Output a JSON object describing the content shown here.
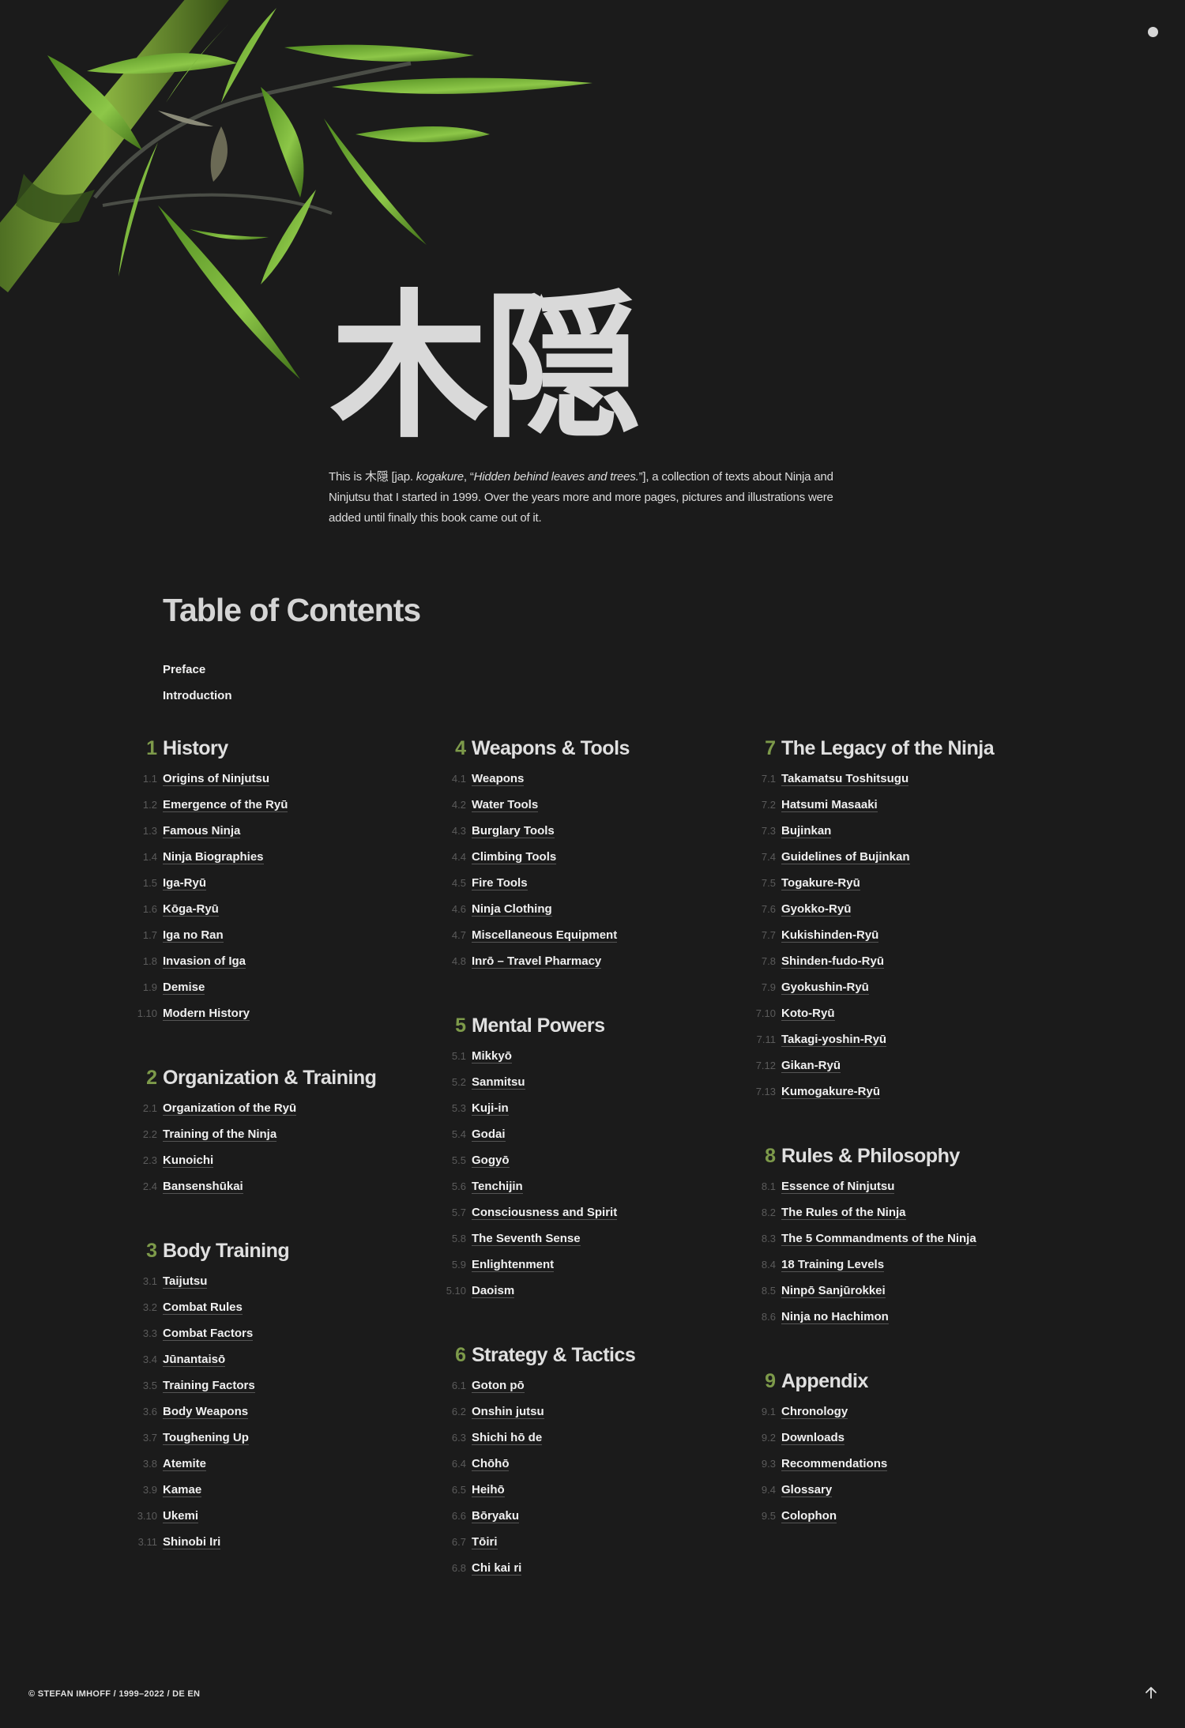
{
  "hero": {
    "kanji": "木隠",
    "intro_before": "This is 木隠 [jap. ",
    "intro_term": "kogakure",
    "intro_mid": ", “",
    "intro_meaning": "Hidden behind leaves and trees.",
    "intro_after": "”], a collection of texts about Ninja and Ninjutsu that I started in 1999. Over the years more and more pages, pictures and illustrations were added until finally this book came out of it."
  },
  "toc": {
    "title": "Table of Contents",
    "front_matter": [
      "Preface",
      "Introduction"
    ],
    "columns": [
      [
        {
          "number": "1",
          "title": "History",
          "items": [
            {
              "num": "1.1",
              "label": "Origins of Ninjutsu"
            },
            {
              "num": "1.2",
              "label": "Emergence of the Ryū"
            },
            {
              "num": "1.3",
              "label": "Famous Ninja"
            },
            {
              "num": "1.4",
              "label": "Ninja Biographies"
            },
            {
              "num": "1.5",
              "label": "Iga-Ryū"
            },
            {
              "num": "1.6",
              "label": "Kōga-Ryū"
            },
            {
              "num": "1.7",
              "label": "Iga no Ran"
            },
            {
              "num": "1.8",
              "label": "Invasion of Iga"
            },
            {
              "num": "1.9",
              "label": "Demise"
            },
            {
              "num": "1.10",
              "label": "Modern History"
            }
          ]
        },
        {
          "number": "2",
          "title": "Organization & Training",
          "items": [
            {
              "num": "2.1",
              "label": "Organization of the Ryū"
            },
            {
              "num": "2.2",
              "label": "Training of the Ninja"
            },
            {
              "num": "2.3",
              "label": "Kunoichi"
            },
            {
              "num": "2.4",
              "label": "Bansenshūkai"
            }
          ]
        },
        {
          "number": "3",
          "title": "Body Training",
          "items": [
            {
              "num": "3.1",
              "label": "Taijutsu"
            },
            {
              "num": "3.2",
              "label": "Combat Rules"
            },
            {
              "num": "3.3",
              "label": "Combat Factors"
            },
            {
              "num": "3.4",
              "label": "Jūnantaisō"
            },
            {
              "num": "3.5",
              "label": "Training Factors"
            },
            {
              "num": "3.6",
              "label": "Body Weapons"
            },
            {
              "num": "3.7",
              "label": "Toughening Up"
            },
            {
              "num": "3.8",
              "label": "Atemite"
            },
            {
              "num": "3.9",
              "label": "Kamae"
            },
            {
              "num": "3.10",
              "label": "Ukemi"
            },
            {
              "num": "3.11",
              "label": "Shinobi Iri"
            }
          ]
        }
      ],
      [
        {
          "number": "4",
          "title": "Weapons & Tools",
          "items": [
            {
              "num": "4.1",
              "label": "Weapons"
            },
            {
              "num": "4.2",
              "label": "Water Tools"
            },
            {
              "num": "4.3",
              "label": "Burglary Tools"
            },
            {
              "num": "4.4",
              "label": "Climbing Tools"
            },
            {
              "num": "4.5",
              "label": "Fire Tools"
            },
            {
              "num": "4.6",
              "label": "Ninja Clothing"
            },
            {
              "num": "4.7",
              "label": "Miscellaneous Equipment"
            },
            {
              "num": "4.8",
              "label": "Inrō – Travel Pharmacy"
            }
          ]
        },
        {
          "number": "5",
          "title": "Mental Powers",
          "items": [
            {
              "num": "5.1",
              "label": "Mikkyō"
            },
            {
              "num": "5.2",
              "label": "Sanmitsu"
            },
            {
              "num": "5.3",
              "label": "Kuji-in"
            },
            {
              "num": "5.4",
              "label": "Godai"
            },
            {
              "num": "5.5",
              "label": "Gogyō"
            },
            {
              "num": "5.6",
              "label": "Tenchijin"
            },
            {
              "num": "5.7",
              "label": "Consciousness and Spirit"
            },
            {
              "num": "5.8",
              "label": "The Seventh Sense"
            },
            {
              "num": "5.9",
              "label": "Enlightenment"
            },
            {
              "num": "5.10",
              "label": "Daoism"
            }
          ]
        },
        {
          "number": "6",
          "title": "Strategy & Tactics",
          "items": [
            {
              "num": "6.1",
              "label": "Goton pō"
            },
            {
              "num": "6.2",
              "label": "Onshin jutsu"
            },
            {
              "num": "6.3",
              "label": "Shichi hō de"
            },
            {
              "num": "6.4",
              "label": "Chōhō"
            },
            {
              "num": "6.5",
              "label": "Heihō"
            },
            {
              "num": "6.6",
              "label": "Bōryaku"
            },
            {
              "num": "6.7",
              "label": "Tōiri"
            },
            {
              "num": "6.8",
              "label": "Chi kai ri"
            }
          ]
        }
      ],
      [
        {
          "number": "7",
          "title": "The Legacy of the Ninja",
          "items": [
            {
              "num": "7.1",
              "label": "Takamatsu Toshitsugu"
            },
            {
              "num": "7.2",
              "label": "Hatsumi Masaaki"
            },
            {
              "num": "7.3",
              "label": "Bujinkan"
            },
            {
              "num": "7.4",
              "label": "Guidelines of Bujinkan"
            },
            {
              "num": "7.5",
              "label": "Togakure-Ryū"
            },
            {
              "num": "7.6",
              "label": "Gyokko-Ryū"
            },
            {
              "num": "7.7",
              "label": "Kukishinden-Ryū"
            },
            {
              "num": "7.8",
              "label": "Shinden-fudo-Ryū"
            },
            {
              "num": "7.9",
              "label": "Gyokushin-Ryū"
            },
            {
              "num": "7.10",
              "label": "Koto-Ryū"
            },
            {
              "num": "7.11",
              "label": "Takagi-yoshin-Ryū"
            },
            {
              "num": "7.12",
              "label": "Gikan-Ryū"
            },
            {
              "num": "7.13",
              "label": "Kumogakure-Ryū"
            }
          ]
        },
        {
          "number": "8",
          "title": "Rules & Philosophy",
          "items": [
            {
              "num": "8.1",
              "label": "Essence of Ninjutsu"
            },
            {
              "num": "8.2",
              "label": "The Rules of the Ninja"
            },
            {
              "num": "8.3",
              "label": "The 5 Commandments of the Ninja"
            },
            {
              "num": "8.4",
              "label": "18 Training Levels"
            },
            {
              "num": "8.5",
              "label": "Ninpō Sanjūrokkei"
            },
            {
              "num": "8.6",
              "label": "Ninja no Hachimon"
            }
          ]
        },
        {
          "number": "9",
          "title": "Appendix",
          "items": [
            {
              "num": "9.1",
              "label": "Chronology"
            },
            {
              "num": "9.2",
              "label": "Downloads"
            },
            {
              "num": "9.3",
              "label": "Recommendations"
            },
            {
              "num": "9.4",
              "label": "Glossary"
            },
            {
              "num": "9.5",
              "label": "Colophon"
            }
          ]
        }
      ]
    ]
  },
  "footer": {
    "text": "© STEFAN IMHOFF / 1999–2022 / DE EN"
  },
  "icons": {
    "menu": "menu-dot-icon",
    "back_to_top": "arrow-up-icon"
  },
  "colors": {
    "background": "#1b1b1b",
    "accent_green": "#7d9a4a",
    "text": "#e6e6e6",
    "muted_number": "#5b5b5b"
  }
}
